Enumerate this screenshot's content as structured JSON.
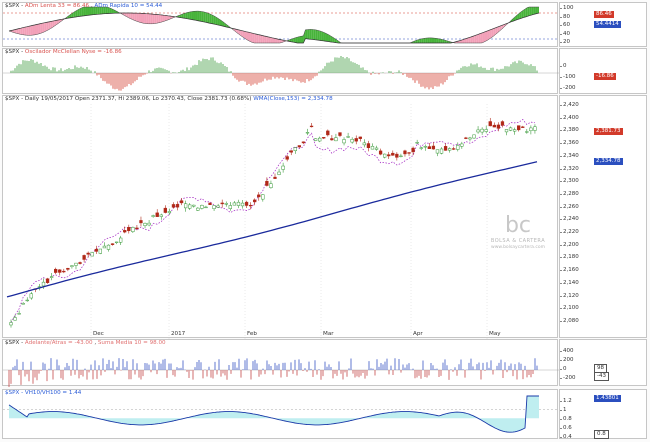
{
  "panels": {
    "adx": {
      "title_symbol": "$SPX",
      "title_series1": "ADm Lenta 33 = 86.46",
      "title_series2": "ADm Rapida 10 = 54.44",
      "ticks": [
        "100",
        "80",
        "60",
        "40",
        "20"
      ],
      "tag_top": "86.46",
      "tag_bottom": "54.4414"
    },
    "osc": {
      "title_symbol": "$SPX",
      "title_text": "Oscilador McClellan Nyse = -16.86",
      "ticks": [
        "0",
        "-100",
        "-200"
      ],
      "tag": "-16.86"
    },
    "price": {
      "title": "$SPX - Daily 19/05/2017 Open 2371.37, Hi 2389.06, Lo 2370.43, Close 2381.73 (0.68%)",
      "wma_label": "WMA(Close,153) = 2,334.78",
      "ticks": [
        "2,420",
        "2,400",
        "2,380",
        "2,360",
        "2,340",
        "2,320",
        "2,300",
        "2,280",
        "2,260",
        "2,240",
        "2,220",
        "2,200",
        "2,180",
        "2,160",
        "2,140",
        "2,120",
        "2,100",
        "2,080"
      ],
      "tag_close": "2,381.73",
      "tag_wma": "2,334.78",
      "months": [
        "Dec",
        "2017",
        "Feb",
        "Mar",
        "Apr",
        "May"
      ],
      "watermark_logo": "bc",
      "watermark_name": "BOLSA & CARTERA",
      "watermark_url": "www.bolsaycartera.com"
    },
    "hist": {
      "title_symbol": "$SPX",
      "title_series1": "Adelante/Atras = -43.00",
      "title_series2": "Suma Media 10 = 98.00",
      "ticks": [
        "400",
        "200",
        "0",
        "-200"
      ],
      "tag1": "98",
      "tag2": "-43"
    },
    "vh": {
      "title": "$SPX - VH10/VH100 = 1.44",
      "ticks": [
        "1.2",
        "1",
        "0.8",
        "0.6",
        "0.4"
      ],
      "tag": "1.43801",
      "tag2": "0.8"
    }
  },
  "colors": {
    "up_candle": "#3a9a3a",
    "down_candle": "#b02818",
    "wma_line": "#1a2a9c",
    "dotted_line": "#a020c0",
    "green_fill": "#47b33a",
    "pink_fill": "#f2a0b8",
    "vh_fill": "#bfeef0",
    "tag_red": "#d23a2a",
    "tag_blue": "#2b4fbf"
  }
}
